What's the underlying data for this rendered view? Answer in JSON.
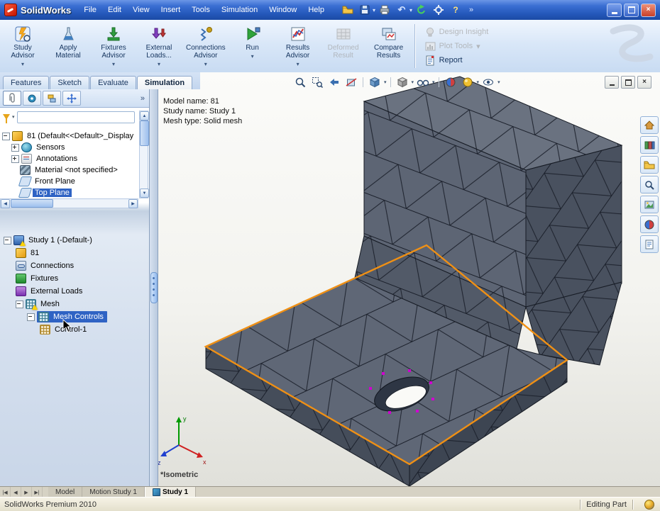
{
  "colors": {
    "accent-orange": "#ef9015",
    "selection-blue": "#2f63c4",
    "magenta": "#cf00cf",
    "face-top": "#6a7280",
    "face-front": "#5d6574",
    "face-right": "#49515f",
    "face-fillet": "#525a68",
    "face-base": "#5f6776",
    "face-sidel": "#454d5a",
    "face-sider": "#3d4552",
    "edge": "#161b24"
  },
  "titlebar": {
    "app_name": "SolidWorks",
    "overflow": "»",
    "menus": [
      {
        "label": "File"
      },
      {
        "label": "Edit"
      },
      {
        "label": "View"
      },
      {
        "label": "Insert"
      },
      {
        "label": "Tools"
      },
      {
        "label": "Simulation"
      },
      {
        "label": "Window"
      },
      {
        "label": "Help"
      }
    ]
  },
  "command_manager": {
    "buttons": [
      {
        "line1": "Study",
        "line2": "Advisor"
      },
      {
        "line1": "Apply",
        "line2": "Material"
      },
      {
        "line1": "Fixtures",
        "line2": "Advisor"
      },
      {
        "line1": "External",
        "line2": "Loads..."
      },
      {
        "line1": "Connections",
        "line2": "Advisor"
      },
      {
        "line1": "Run",
        "line2": ""
      },
      {
        "line1": "Results",
        "line2": "Advisor"
      },
      {
        "line1": "Deformed",
        "line2": "Result"
      },
      {
        "line1": "Compare",
        "line2": "Results"
      }
    ],
    "side_buttons": [
      {
        "label": "Design Insight"
      },
      {
        "label": "Plot Tools"
      },
      {
        "label": "Report"
      }
    ]
  },
  "document_tabs": {
    "tabs": [
      {
        "label": "Features"
      },
      {
        "label": "Sketch"
      },
      {
        "label": "Evaluate"
      },
      {
        "label": "Simulation"
      }
    ]
  },
  "feature_tree": {
    "filter_value": "",
    "items": [
      {
        "label": "81 (Default<<Default>_Display"
      },
      {
        "label": "Sensors"
      },
      {
        "label": "Annotations"
      },
      {
        "label": "Material <not specified>"
      },
      {
        "label": "Front Plane"
      },
      {
        "label": "Top Plane"
      }
    ]
  },
  "study_tree": {
    "items": [
      {
        "label": "Study 1 (-Default-)"
      },
      {
        "label": "81"
      },
      {
        "label": "Connections"
      },
      {
        "label": "Fixtures"
      },
      {
        "label": "External Loads"
      },
      {
        "label": "Mesh"
      },
      {
        "label": "Mesh Controls"
      },
      {
        "label": "Control-1"
      }
    ]
  },
  "viewport": {
    "info_line1": "Model name: 81",
    "info_line2": "Study name: Study 1",
    "info_line3": "Mesh type: Solid mesh",
    "view_label": "*Isometric",
    "triad": {
      "x": "x",
      "y": "y",
      "z": "z"
    }
  },
  "bottom_tabs": {
    "tabs": [
      {
        "label": "Model"
      },
      {
        "label": "Motion Study 1"
      },
      {
        "label": "Study 1"
      }
    ]
  },
  "status_bar": {
    "left": "SolidWorks Premium 2010",
    "right": "Editing Part"
  }
}
